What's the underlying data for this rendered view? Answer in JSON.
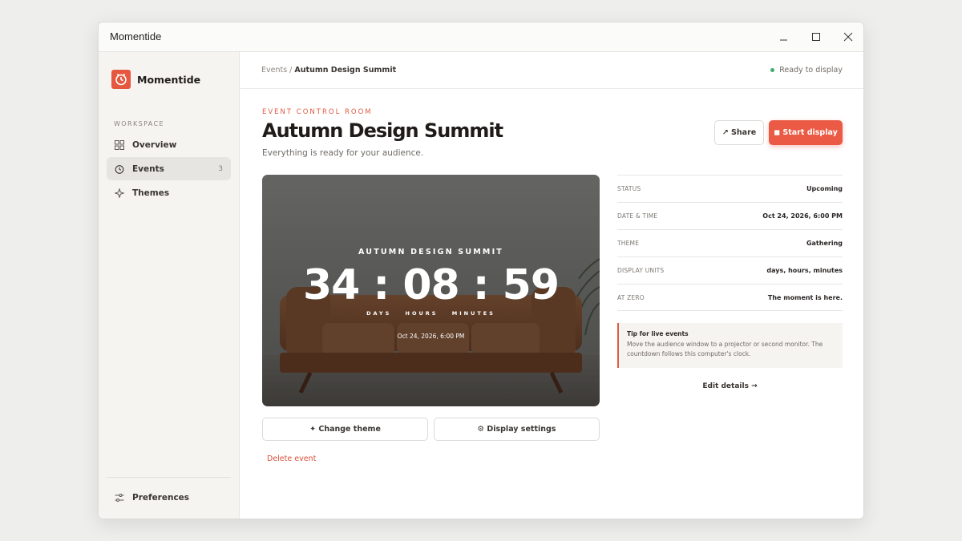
{
  "window": {
    "title": "Momentide"
  },
  "sidebar": {
    "brand": "Momentide",
    "section_label": "WORKSPACE",
    "items": [
      {
        "label": "Overview",
        "icon": "grid-icon",
        "count": ""
      },
      {
        "label": "Events",
        "icon": "clock-icon",
        "count": "3"
      },
      {
        "label": "Themes",
        "icon": "sparkle-icon",
        "count": ""
      }
    ],
    "footer_item": {
      "label": "Preferences",
      "icon": "sliders-icon"
    }
  },
  "topbar": {
    "breadcrumb_parent": "Events /",
    "breadcrumb_current": "Autumn Design Summit",
    "status": "Ready to display"
  },
  "header": {
    "eyebrow": "EVENT CONTROL ROOM",
    "title": "Autumn Design Summit",
    "subtitle": "Everything is ready for your audience.",
    "share_label": "↗ Share",
    "start_label": "◼ Start display"
  },
  "preview": {
    "event_name": "AUTUMN DESIGN SUMMIT",
    "countdown": "34 : 08 : 59",
    "units": [
      "DAYS",
      "HOURS",
      "MINUTES"
    ],
    "date": "Oct 24, 2026, 6:00 PM"
  },
  "actions": {
    "change_theme": "✦ Change theme",
    "display_settings": "⚙ Display settings",
    "delete": "Delete event"
  },
  "details": [
    {
      "key": "STATUS",
      "value": "Upcoming"
    },
    {
      "key": "DATE & TIME",
      "value": "Oct 24, 2026, 6:00 PM"
    },
    {
      "key": "THEME",
      "value": "Gathering"
    },
    {
      "key": "DISPLAY UNITS",
      "value": "days, hours, minutes"
    },
    {
      "key": "AT ZERO",
      "value": "The moment is here."
    }
  ],
  "tip": {
    "title": "Tip for live events",
    "body": "Move the audience window to a projector or second monitor. The countdown follows this computer's clock."
  },
  "edit_label": "Edit details →",
  "colors": {
    "accent": "#ea5a44",
    "ready": "#3fae6a",
    "sidebar_bg": "#f5f4f1"
  }
}
